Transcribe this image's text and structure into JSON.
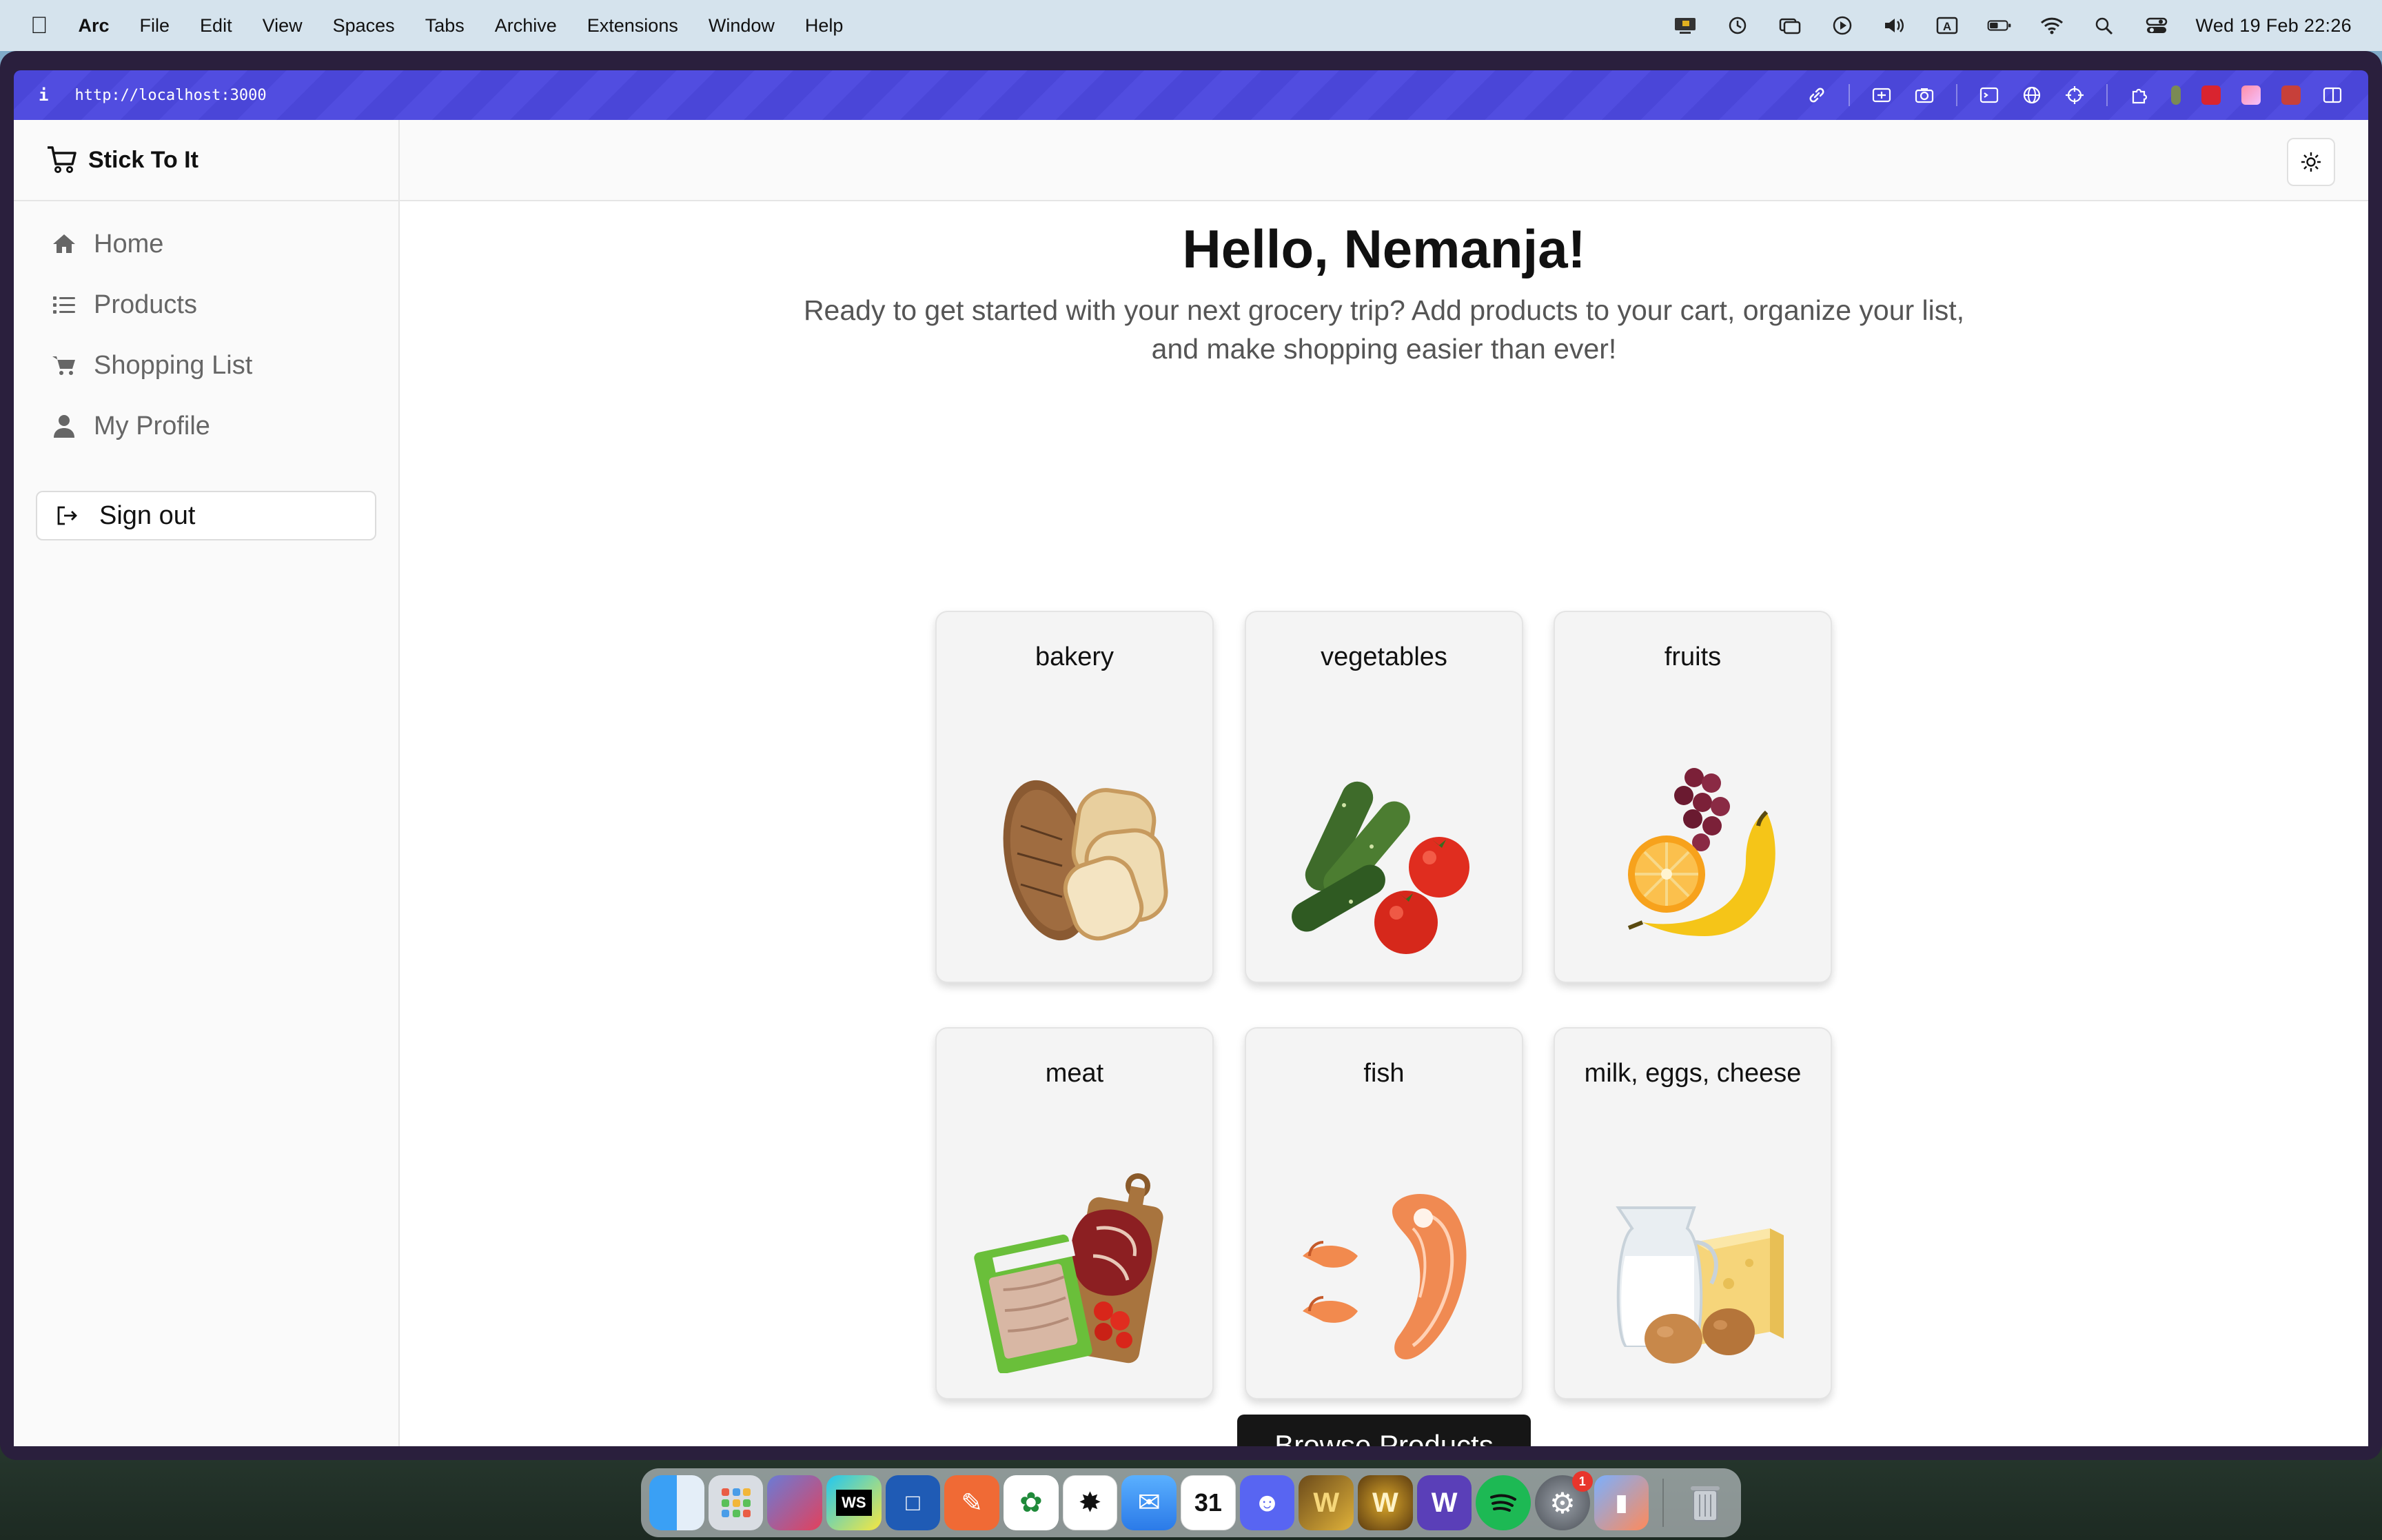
{
  "menubar": {
    "app_name": "Arc",
    "items": [
      "File",
      "Edit",
      "View",
      "Spaces",
      "Tabs",
      "Archive",
      "Extensions",
      "Window",
      "Help"
    ],
    "status_icons": [
      "screen-share-icon",
      "time-machine-icon",
      "window-icon",
      "play-icon",
      "volume-icon",
      "input-source-icon",
      "battery-icon",
      "wifi-icon",
      "spotlight-icon",
      "control-center-icon"
    ],
    "input_source": "A",
    "clock": "Wed 19 Feb  22:26"
  },
  "browser": {
    "info_glyph": "i",
    "url": "http://localhost:3000",
    "accent": "#4a46d8"
  },
  "sidebar": {
    "brand": "Stick To It",
    "items": [
      {
        "label": "Home",
        "icon": "home-icon"
      },
      {
        "label": "Products",
        "icon": "list-icon"
      },
      {
        "label": "Shopping List",
        "icon": "cart-icon"
      },
      {
        "label": "My Profile",
        "icon": "user-icon"
      }
    ],
    "signout_label": "Sign out"
  },
  "main": {
    "greeting": "Hello, Nemanja!",
    "subtitle": "Ready to get started with your next grocery trip? Add products to your cart, organize your list, and make shopping easier than ever!",
    "categories": [
      {
        "label": "bakery",
        "image": "bakery-image"
      },
      {
        "label": "vegetables",
        "image": "vegetables-image"
      },
      {
        "label": "fruits",
        "image": "fruits-image"
      },
      {
        "label": "meat",
        "image": "meat-image"
      },
      {
        "label": "fish",
        "image": "fish-image"
      },
      {
        "label": "milk, eggs, cheese",
        "image": "dairy-image"
      }
    ],
    "browse_button": "Browse Products"
  },
  "dock": {
    "apps": [
      "Finder",
      "Launchpad",
      "Affinity",
      "WebStorm",
      "Microsoft Remote Desktop",
      "Pencil",
      "MongoDB Compass",
      "ChatGPT",
      "Mail",
      "Calendar",
      "Discord",
      "World of Warcraft",
      "Battle.net",
      "Wordle",
      "Spotify",
      "System Settings",
      "iPhone Mirroring",
      "Trash"
    ],
    "calendar_day": "31",
    "settings_badge": "1"
  }
}
